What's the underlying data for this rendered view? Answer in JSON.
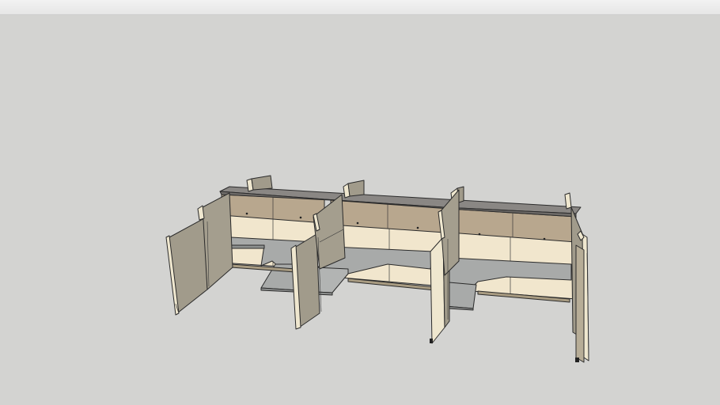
{
  "app": {
    "background_color": "#d3d3d1",
    "toolbar_color": "#eeeeee"
  },
  "model": {
    "subject": "workstation-cubicles",
    "workstation_count": 3,
    "colors": {
      "panel_side": "#a19b8b",
      "panel_back": "#f1e6cd",
      "overhead_bin": "#b8a78e",
      "worksurface": "#a8aaa9",
      "post_edge": "#efe7cf",
      "top_rail": "#8a8784",
      "outline": "#2b2b2b"
    }
  }
}
